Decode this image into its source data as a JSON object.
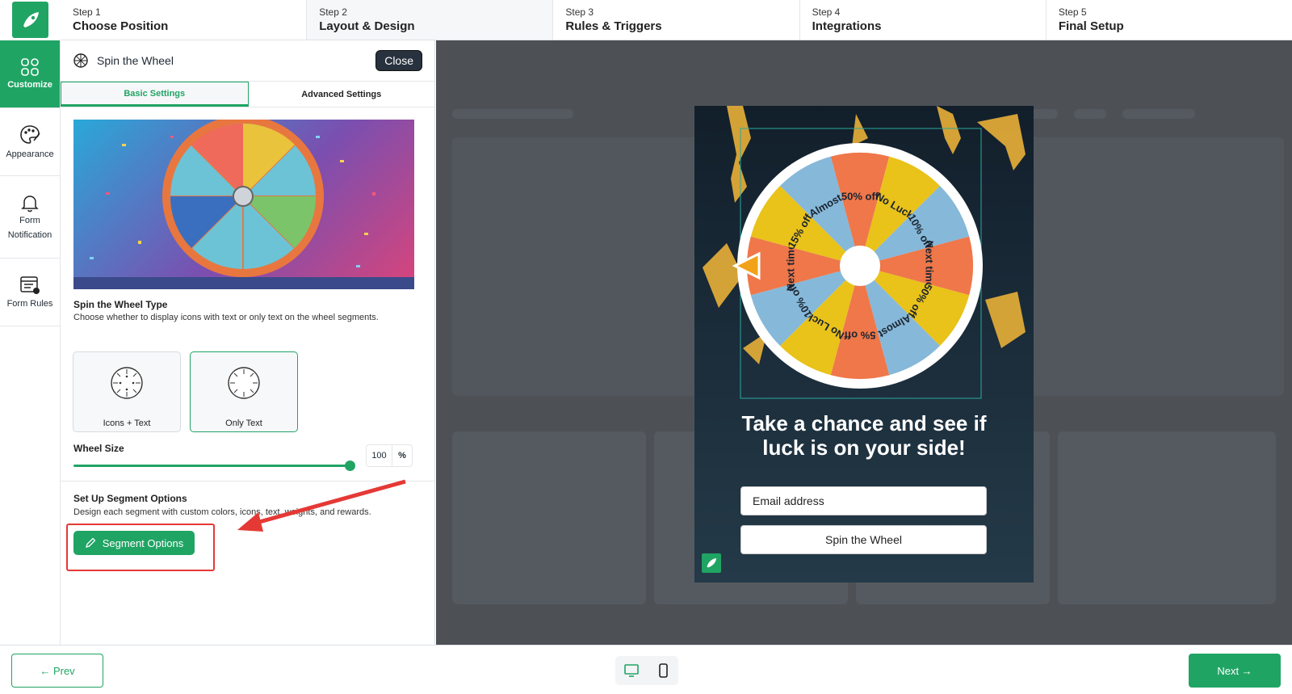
{
  "steps": [
    {
      "num": "Step 1",
      "label": "Choose Position"
    },
    {
      "num": "Step 2",
      "label": "Layout & Design"
    },
    {
      "num": "Step 3",
      "label": "Rules & Triggers"
    },
    {
      "num": "Step 4",
      "label": "Integrations"
    },
    {
      "num": "Step 5",
      "label": "Final Setup"
    }
  ],
  "rail": {
    "customize": "Customize",
    "appearance": "Appearance",
    "form_notification_1": "Form",
    "form_notification_2": "Notification",
    "form_rules": "Form Rules"
  },
  "panel": {
    "title": "Spin the Wheel",
    "close": "Close",
    "tab_basic": "Basic Settings",
    "tab_advanced": "Advanced Settings",
    "type_title": "Spin the Wheel Type",
    "type_desc": "Choose whether to display icons with text or only text on the wheel segments.",
    "type_option_1": "Icons + Text",
    "type_option_2": "Only Text",
    "wheel_size_label": "Wheel Size",
    "wheel_size_value": "100",
    "wheel_size_unit": "%",
    "wheel_size_fraction": 1.0,
    "segment_title": "Set Up Segment Options",
    "segment_desc": "Design each segment with custom colors, icons, text, weights, and rewards.",
    "segment_button": "Segment Options"
  },
  "popup": {
    "wheel_segments": [
      "50% off",
      "No Luck",
      "10% off",
      "Next time!",
      "50% off",
      "Almost",
      "5% off",
      "No Luck",
      "10% off",
      "Next time!",
      "15% off",
      "Almost"
    ],
    "segment_colors": [
      "#ef7749",
      "#e9c21a",
      "#86b8d9"
    ],
    "headline_1": "Take a chance and see if",
    "headline_2": "luck is on your side!",
    "email_placeholder": "Email address",
    "spin_button": "Spin the Wheel"
  },
  "footer": {
    "prev": "← Prev",
    "next": "Next →"
  },
  "colors": {
    "brand": "#20a464",
    "highlight": "#e53935",
    "close_bg": "#27323e"
  }
}
